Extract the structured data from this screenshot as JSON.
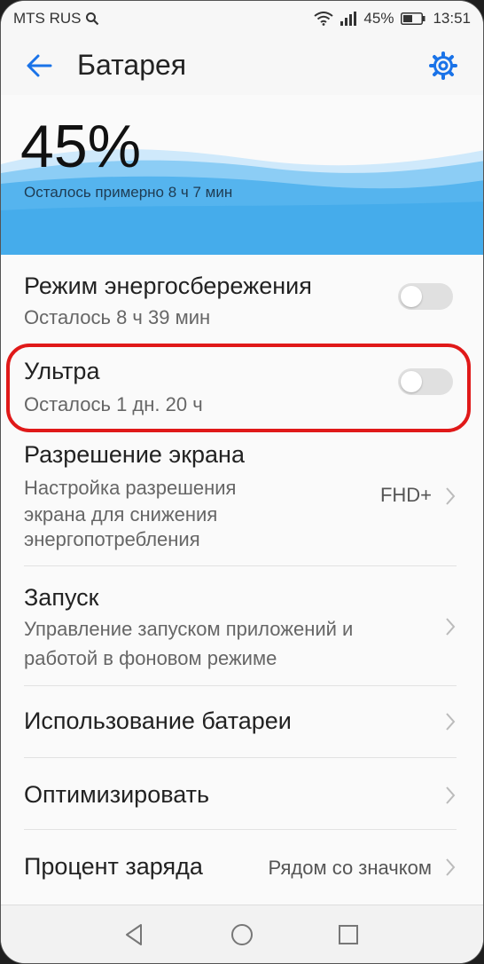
{
  "status_bar": {
    "carrier": "MTS RUS",
    "battery_percent": "45%",
    "time": "13:51",
    "icons": [
      "search-icon",
      "wifi-icon",
      "signal-icon",
      "battery-icon"
    ]
  },
  "header": {
    "title": "Батарея",
    "back_icon": "back-arrow-icon",
    "settings_icon": "gear-icon"
  },
  "battery": {
    "level_percent": "45%",
    "remaining": "Осталось примерно 8 ч 7 мин"
  },
  "settings": {
    "power_saving": {
      "title": "Режим энергосбережения",
      "subtitle": "Осталось 8 ч 39 мин",
      "enabled": false
    },
    "ultra": {
      "title": "Ультра",
      "subtitle": "Осталось 1 дн. 20 ч",
      "enabled": false,
      "highlight_color": "#e01919"
    },
    "screen_resolution": {
      "title": "Разрешение экрана",
      "subtitle_lines": [
        "Настройка разрешения",
        "экрана для снижения",
        "энергопотребления"
      ],
      "value": "FHD+"
    },
    "launch": {
      "title": "Запуск",
      "subtitle_lines": [
        "Управление запуском приложений и",
        "работой в фоновом режиме"
      ]
    },
    "battery_usage": {
      "title": "Использование батареи"
    },
    "optimize": {
      "title": "Оптимизировать"
    },
    "charge_percent": {
      "title": "Процент заряда",
      "value": "Рядом со значком"
    }
  },
  "nav_bar": {
    "buttons": [
      "back-triangle-icon",
      "home-circle-icon",
      "recents-square-icon"
    ]
  },
  "colors": {
    "accent": "#1a73e8",
    "wave_light": "#cfe9fb",
    "wave_mid": "#8ccdf5",
    "wave_deep": "#3aa6ea"
  }
}
